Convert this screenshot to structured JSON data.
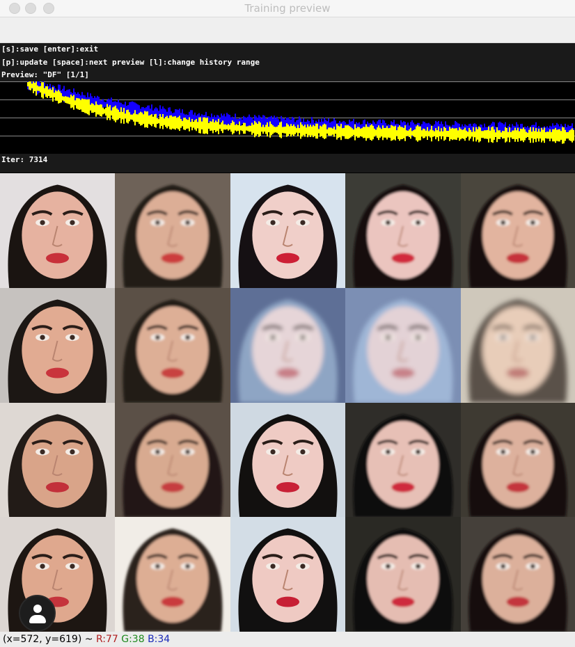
{
  "window": {
    "title": "Training preview"
  },
  "panel": {
    "line1": "[s]:save [enter]:exit",
    "line2": "[p]:update [space]:next preview [l]:change history range",
    "line3": "Preview: \"DF\" [1/1]",
    "iter": "Iter: 7314"
  },
  "loss_history": {
    "series": [
      {
        "color": "#1400ff",
        "values": [
          1.0,
          0.92,
          0.84,
          0.76,
          0.69,
          0.63,
          0.58,
          0.54,
          0.5,
          0.47,
          0.44,
          0.42,
          0.4,
          0.38,
          0.37,
          0.36,
          0.35,
          0.34,
          0.33,
          0.32,
          0.31,
          0.305,
          0.3,
          0.295,
          0.29,
          0.285,
          0.28,
          0.28,
          0.275,
          0.27
        ]
      },
      {
        "color": "#ffff00",
        "values": [
          1.0,
          0.88,
          0.76,
          0.66,
          0.58,
          0.51,
          0.46,
          0.42,
          0.39,
          0.36,
          0.34,
          0.32,
          0.3,
          0.29,
          0.28,
          0.27,
          0.26,
          0.25,
          0.245,
          0.24,
          0.235,
          0.23,
          0.225,
          0.22,
          0.215,
          0.21,
          0.21,
          0.205,
          0.2,
          0.2
        ]
      }
    ]
  },
  "preview_grid": {
    "tiles": [
      {
        "bg": "#e3dfe0",
        "hair": "#1a1411",
        "skin": "#e6b2a0",
        "mouth": "#c8303a",
        "blur": 0.0
      },
      {
        "bg": "#6e6258",
        "hair": "#231c18",
        "skin": "#dcae96",
        "mouth": "#cc3c3c",
        "blur": 1.2
      },
      {
        "bg": "#d7e3ee",
        "hair": "#151013",
        "skin": "#f0cfc9",
        "mouth": "#cd1f35",
        "blur": 0.0
      },
      {
        "bg": "#3c3c36",
        "hair": "#120f0e",
        "skin": "#ebc5bf",
        "mouth": "#d22a3c",
        "blur": 1.0
      },
      {
        "bg": "#4a463d",
        "hair": "#141110",
        "skin": "#e2b49f",
        "mouth": "#c6333a",
        "blur": 1.2
      },
      {
        "bg": "#c6c2bf",
        "hair": "#1c1714",
        "skin": "#e1ab92",
        "mouth": "#c9343c",
        "blur": 0.0
      },
      {
        "bg": "#5b5046",
        "hair": "#221a16",
        "skin": "#ddaf96",
        "mouth": "#c8433f",
        "blur": 1.2
      },
      {
        "bg": "#5e6f96",
        "hair": "#8ea5c4",
        "skin": "#e6d5d8",
        "mouth": "#c77e86",
        "blur": 2.0
      },
      {
        "bg": "#7c8fb4",
        "hair": "#9fb6d6",
        "skin": "#e3d2d6",
        "mouth": "#c78188",
        "blur": 2.0
      },
      {
        "bg": "#cfc8bb",
        "hair": "#5a5148",
        "skin": "#e8cdb9",
        "mouth": "#c07a76",
        "blur": 2.2
      },
      {
        "bg": "#ded8d3",
        "hair": "#221b17",
        "skin": "#d9a489",
        "mouth": "#c2303a",
        "blur": 0.0
      },
      {
        "bg": "#5b5047",
        "hair": "#211914",
        "skin": "#d8aa90",
        "mouth": "#c63d3f",
        "blur": 1.2
      },
      {
        "bg": "#cfd9e2",
        "hair": "#12100f",
        "skin": "#efcbc4",
        "mouth": "#c82136",
        "blur": 0.0
      },
      {
        "bg": "#2f2d29",
        "hair": "#0f0d0c",
        "skin": "#e7c0b6",
        "mouth": "#cf2b3d",
        "blur": 1.0
      },
      {
        "bg": "#3e3a32",
        "hair": "#13100f",
        "skin": "#ddb19d",
        "mouth": "#c4363c",
        "blur": 1.2
      },
      {
        "bg": "#dcd6d2",
        "hair": "#1d1612",
        "skin": "#dfa88e",
        "mouth": "#c5343c",
        "blur": 0.0
      },
      {
        "bg": "#f1ede7",
        "hair": "#2a201a",
        "skin": "#ddae94",
        "mouth": "#c93a3c",
        "blur": 1.2
      },
      {
        "bg": "#d3dde6",
        "hair": "#111010",
        "skin": "#efcac3",
        "mouth": "#c71f34",
        "blur": 0.0
      },
      {
        "bg": "#2a2924",
        "hair": "#0f0d0c",
        "skin": "#e5bdb2",
        "mouth": "#ce2a3c",
        "blur": 1.0
      },
      {
        "bg": "#45403a",
        "hair": "#141110",
        "skin": "#dcb09b",
        "mouth": "#c3363c",
        "blur": 1.2
      }
    ]
  },
  "status": {
    "coords": "(x=572, y=619) ~ ",
    "r": "R:77",
    "g": "G:38",
    "b": "B:34"
  }
}
